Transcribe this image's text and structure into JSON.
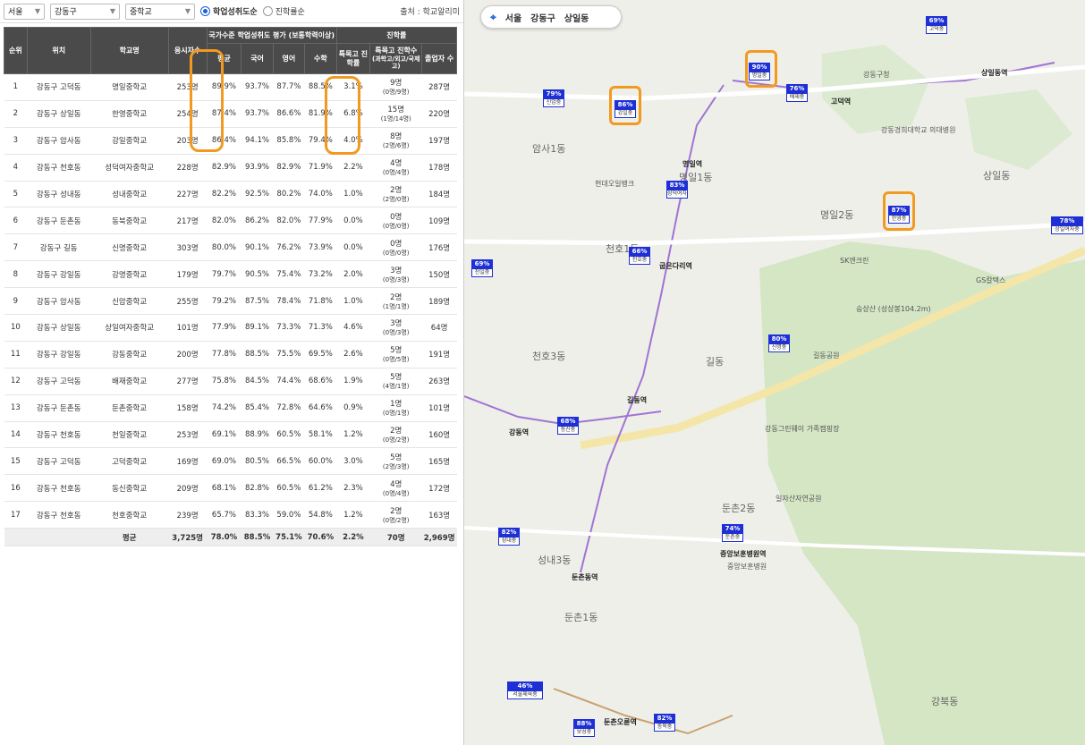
{
  "filters": {
    "region": "서울",
    "district": "강동구",
    "school_type": "중학교"
  },
  "sort": {
    "option1": "학업성취도순",
    "option2": "진학률순",
    "selected": 1
  },
  "source": "출처 : 학교알리미",
  "table": {
    "h_rank": "순위",
    "h_loc": "위치",
    "h_school": "학교명",
    "h_count": "응시자수",
    "h_eval": "국가수준 학업성취도 평가 (보통학력이상)",
    "h_avg": "평균",
    "h_kor": "국어",
    "h_eng": "영어",
    "h_math": "수학",
    "h_adv": "진학률",
    "h_rate": "특목고 진학률",
    "h_cnt": "특목고 진학수",
    "h_cnt_sub": "(과학고/외고/국제고)",
    "h_grad": "졸업자 수",
    "rows": [
      {
        "r": "1",
        "loc": "강동구 고덕동",
        "name": "명일중학교",
        "n": "253명",
        "avg": "89.9%",
        "kor": "93.7%",
        "eng": "87.7%",
        "math": "88.5%",
        "rate": "3.1%",
        "cnt": "9명",
        "cnt2": "(0명/9명)",
        "grad": "287명"
      },
      {
        "r": "2",
        "loc": "강동구 상일동",
        "name": "한영중학교",
        "n": "254명",
        "avg": "87.4%",
        "kor": "93.7%",
        "eng": "86.6%",
        "math": "81.9%",
        "rate": "6.8%",
        "cnt": "15명",
        "cnt2": "(1명/14명)",
        "grad": "220명"
      },
      {
        "r": "3",
        "loc": "강동구 암사동",
        "name": "강일중학교",
        "n": "203명",
        "avg": "86.4%",
        "kor": "94.1%",
        "eng": "85.8%",
        "math": "79.4%",
        "rate": "4.0%",
        "cnt": "8명",
        "cnt2": "(2명/6명)",
        "grad": "197명"
      },
      {
        "r": "4",
        "loc": "강동구 천호동",
        "name": "성덕여자중학교",
        "n": "228명",
        "avg": "82.9%",
        "kor": "93.9%",
        "eng": "82.9%",
        "math": "71.9%",
        "rate": "2.2%",
        "cnt": "4명",
        "cnt2": "(0명/4명)",
        "grad": "178명"
      },
      {
        "r": "5",
        "loc": "강동구 성내동",
        "name": "성내중학교",
        "n": "227명",
        "avg": "82.2%",
        "kor": "92.5%",
        "eng": "80.2%",
        "math": "74.0%",
        "rate": "1.0%",
        "cnt": "2명",
        "cnt2": "(2명/0명)",
        "grad": "184명"
      },
      {
        "r": "6",
        "loc": "강동구 둔촌동",
        "name": "동북중학교",
        "n": "217명",
        "avg": "82.0%",
        "kor": "86.2%",
        "eng": "82.0%",
        "math": "77.9%",
        "rate": "0.0%",
        "cnt": "0명",
        "cnt2": "(0명/0명)",
        "grad": "109명"
      },
      {
        "r": "7",
        "loc": "강동구 길동",
        "name": "신명중학교",
        "n": "303명",
        "avg": "80.0%",
        "kor": "90.1%",
        "eng": "76.2%",
        "math": "73.9%",
        "rate": "0.0%",
        "cnt": "0명",
        "cnt2": "(0명/0명)",
        "grad": "176명"
      },
      {
        "r": "8",
        "loc": "강동구 강일동",
        "name": "강명중학교",
        "n": "179명",
        "avg": "79.7%",
        "kor": "90.5%",
        "eng": "75.4%",
        "math": "73.2%",
        "rate": "2.0%",
        "cnt": "3명",
        "cnt2": "(0명/3명)",
        "grad": "150명"
      },
      {
        "r": "9",
        "loc": "강동구 암사동",
        "name": "신암중학교",
        "n": "255명",
        "avg": "79.2%",
        "kor": "87.5%",
        "eng": "78.4%",
        "math": "71.8%",
        "rate": "1.0%",
        "cnt": "2명",
        "cnt2": "(1명/1명)",
        "grad": "189명"
      },
      {
        "r": "10",
        "loc": "강동구 상일동",
        "name": "상일여자중학교",
        "n": "101명",
        "avg": "77.9%",
        "kor": "89.1%",
        "eng": "73.3%",
        "math": "71.3%",
        "rate": "4.6%",
        "cnt": "3명",
        "cnt2": "(0명/3명)",
        "grad": "64명"
      },
      {
        "r": "11",
        "loc": "강동구 강일동",
        "name": "강동중학교",
        "n": "200명",
        "avg": "77.8%",
        "kor": "88.5%",
        "eng": "75.5%",
        "math": "69.5%",
        "rate": "2.6%",
        "cnt": "5명",
        "cnt2": "(0명/5명)",
        "grad": "191명"
      },
      {
        "r": "12",
        "loc": "강동구 고덕동",
        "name": "배재중학교",
        "n": "277명",
        "avg": "75.8%",
        "kor": "84.5%",
        "eng": "74.4%",
        "math": "68.6%",
        "rate": "1.9%",
        "cnt": "5명",
        "cnt2": "(4명/1명)",
        "grad": "263명"
      },
      {
        "r": "13",
        "loc": "강동구 둔촌동",
        "name": "둔촌중학교",
        "n": "158명",
        "avg": "74.2%",
        "kor": "85.4%",
        "eng": "72.8%",
        "math": "64.6%",
        "rate": "0.9%",
        "cnt": "1명",
        "cnt2": "(0명/1명)",
        "grad": "101명"
      },
      {
        "r": "14",
        "loc": "강동구 천호동",
        "name": "천일중학교",
        "n": "253명",
        "avg": "69.1%",
        "kor": "88.9%",
        "eng": "60.5%",
        "math": "58.1%",
        "rate": "1.2%",
        "cnt": "2명",
        "cnt2": "(0명/2명)",
        "grad": "160명"
      },
      {
        "r": "15",
        "loc": "강동구 고덕동",
        "name": "고덕중학교",
        "n": "169명",
        "avg": "69.0%",
        "kor": "80.5%",
        "eng": "66.5%",
        "math": "60.0%",
        "rate": "3.0%",
        "cnt": "5명",
        "cnt2": "(2명/3명)",
        "grad": "165명"
      },
      {
        "r": "16",
        "loc": "강동구 천호동",
        "name": "동신중학교",
        "n": "209명",
        "avg": "68.1%",
        "kor": "82.8%",
        "eng": "60.5%",
        "math": "61.2%",
        "rate": "2.3%",
        "cnt": "4명",
        "cnt2": "(0명/4명)",
        "grad": "172명"
      },
      {
        "r": "17",
        "loc": "강동구 천호동",
        "name": "천호중학교",
        "n": "239명",
        "avg": "65.7%",
        "kor": "83.3%",
        "eng": "59.0%",
        "math": "54.8%",
        "rate": "1.2%",
        "cnt": "2명",
        "cnt2": "(0명/2명)",
        "grad": "163명"
      }
    ],
    "total": {
      "label": "평균",
      "n": "3,725명",
      "avg": "78.0%",
      "kor": "88.5%",
      "eng": "75.1%",
      "math": "70.6%",
      "rate": "2.2%",
      "cnt": "70명",
      "grad": "2,969명"
    }
  },
  "map": {
    "crumbs": [
      "서울",
      "강동구",
      "상일동"
    ],
    "flags": [
      {
        "pct": "69%",
        "name": "고덕중"
      },
      {
        "pct": "90%",
        "name": "명일중"
      },
      {
        "pct": "76%",
        "name": "배재중"
      },
      {
        "pct": "79%",
        "name": "신암중"
      },
      {
        "pct": "86%",
        "name": "강일중"
      },
      {
        "pct": "83%",
        "name": "성덕여자중"
      },
      {
        "pct": "87%",
        "name": "한영중"
      },
      {
        "pct": "78%",
        "name": "상일여자중"
      },
      {
        "pct": "66%",
        "name": "천호중"
      },
      {
        "pct": "69%",
        "name": "천일중"
      },
      {
        "pct": "80%",
        "name": "신명중"
      },
      {
        "pct": "68%",
        "name": "동신중"
      },
      {
        "pct": "74%",
        "name": "둔촌중"
      },
      {
        "pct": "82%",
        "name": "성내중"
      },
      {
        "pct": "46%",
        "name": "서울체육중"
      },
      {
        "pct": "88%",
        "name": "보성중"
      },
      {
        "pct": "82%",
        "name": "동북중"
      }
    ],
    "labels": [
      "명일1동",
      "명일2동",
      "천호1동",
      "천호3동",
      "길동",
      "둔촌2동",
      "성내3동",
      "둔촌1동",
      "암사1동",
      "상일동",
      "강북동",
      "고덕역",
      "명일역",
      "굽은다리역",
      "길동역",
      "강동역",
      "둔촌동역",
      "둔촌오륜역",
      "상일동역",
      "중앙보훈병원역",
      "일자산자연공원",
      "길동공원",
      "강동그린웨이 가족캠핑장",
      "승상산 (성상봉104.2m)",
      "SK엔크린",
      "GS칼텍스",
      "현대오일뱅크",
      "강동구청",
      "강동경희대학교 의대병원",
      "중앙보훈병원"
    ]
  }
}
